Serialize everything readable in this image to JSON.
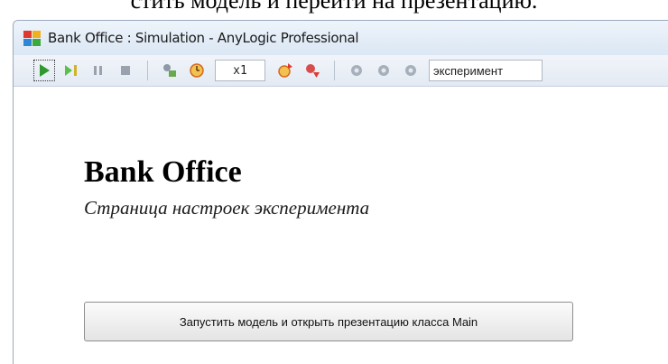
{
  "document": {
    "caption": "стить модель и перейти на презентацию."
  },
  "window": {
    "title": "Bank Office : Simulation - AnyLogic Professional",
    "toolbar": {
      "speed": "x1",
      "experiment_field": "эксперимент"
    }
  },
  "page": {
    "title": "Bank Office",
    "subtitle": "Страница настроек эксперимента",
    "run_button_label": "Запустить модель и открыть презентацию класса Main"
  },
  "colors": {
    "play_green": "#2e9a2e",
    "titlebar_top": "#eef4fb",
    "toolbar_bg": "#e3eaf3"
  },
  "icons": [
    "app-icon",
    "run-icon",
    "step-icon",
    "pause-icon",
    "stop-icon",
    "agents-icon",
    "clock-icon",
    "speed-up-icon",
    "speed-down-icon",
    "gear-icon-1",
    "gear-icon-2",
    "gear-icon-3"
  ]
}
